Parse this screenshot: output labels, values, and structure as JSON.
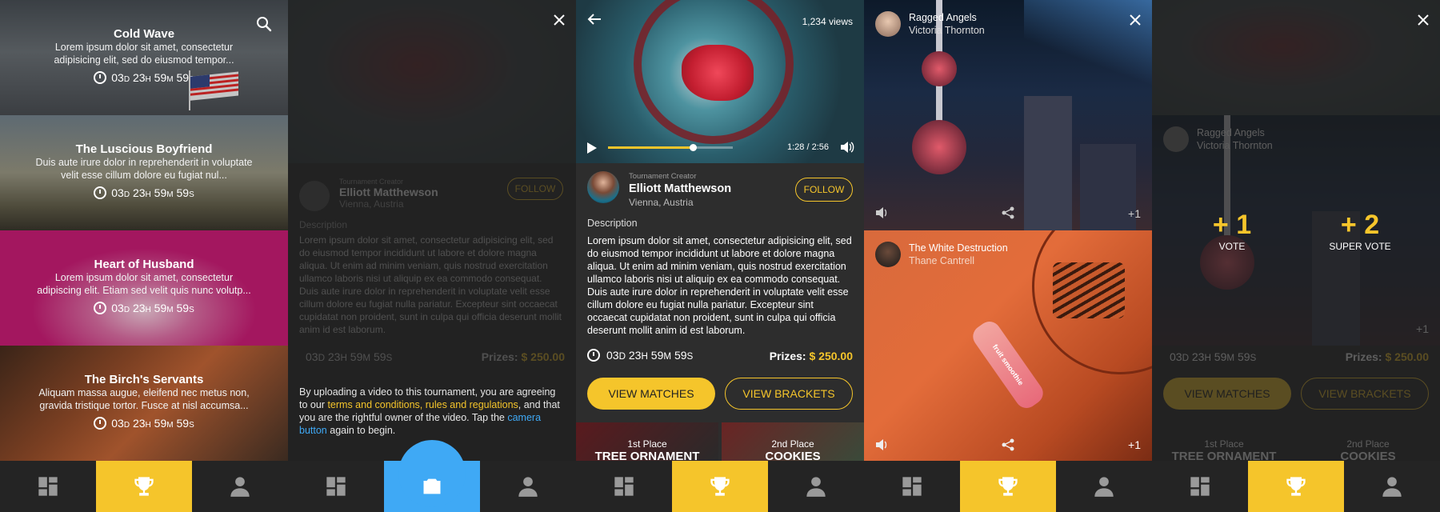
{
  "panel1": {
    "cards": [
      {
        "title": "Cold Wave",
        "desc": "Lorem ipsum dolor sit amet, consectetur adipisicing elit, sed do eiusmod tempor...",
        "timer": {
          "d": "03",
          "h": "23",
          "m": "59",
          "s": "59"
        }
      },
      {
        "title": "The Luscious Boyfriend",
        "desc": "Duis aute irure dolor in reprehenderit in voluptate velit esse cillum dolore eu fugiat nul...",
        "timer": {
          "d": "03",
          "h": "23",
          "m": "59",
          "s": "59"
        }
      },
      {
        "title": "Heart of Husband",
        "desc": "Lorem ipsum dolor sit amet, consectetur adipiscing elit. Etiam sed velit quis nunc volutp...",
        "timer": {
          "d": "03",
          "h": "23",
          "m": "59",
          "s": "59"
        }
      },
      {
        "title": "The Birch's Servants",
        "desc": "Aliquam massa augue, eleifend nec metus non, gravida tristique tortor. Fusce at nisl accumsa...",
        "timer": {
          "d": "03",
          "h": "23",
          "m": "59",
          "s": "59"
        }
      }
    ]
  },
  "unit_labels": {
    "d": "D",
    "h": "H",
    "m": "M",
    "s": "S"
  },
  "video": {
    "views": "1,234 views",
    "time": "1:28 / 2:56",
    "progress": 0.68
  },
  "creator": {
    "role": "Tournament Creator",
    "name": "Elliott Matthewson",
    "location": "Vienna, Austria",
    "follow": "FOLLOW"
  },
  "description": {
    "heading": "Description",
    "body": "Lorem ipsum dolor sit amet, consectetur adipisicing elit, sed do eiusmod tempor incididunt ut labore et dolore magna aliqua. Ut enim ad minim veniam, quis nostrud exercitation ullamco laboris nisi ut aliquip ex ea commodo consequat. Duis aute irure dolor in reprehenderit in voluptate velit esse cillum dolore eu fugiat nulla pariatur. Excepteur sint occaecat cupidatat non proident, sunt in culpa qui officia deserunt mollit anim id est laborum."
  },
  "timer": {
    "d": "03",
    "h": "23",
    "m": "59",
    "s": "59"
  },
  "prizes": {
    "label": "Prizes:",
    "value": "$ 250.00"
  },
  "buttons": {
    "view_matches": "VIEW MATCHES",
    "view_brackets": "VIEW BRACKETS"
  },
  "places": [
    {
      "place": "1st Place",
      "name": "TREE ORNAMENT"
    },
    {
      "place": "2nd Place",
      "name": "COOKIES"
    }
  ],
  "upload": {
    "p1": "By uploading a video to this tournament, you are agreeing to our ",
    "link1": "terms and conditions, rules and regulations",
    "p2": ", and that you are the rightful owner of the video. Tap the ",
    "link2": "camera button",
    "p3": " again to begin."
  },
  "match": {
    "top": {
      "title": "Ragged Angels",
      "user": "Victoria Thornton",
      "count": "+1"
    },
    "bottom": {
      "title": "The White Destruction",
      "user": "Thane Cantrell",
      "count": "+1",
      "bottle_text": "fruit smoothie"
    }
  },
  "votes": {
    "vote": {
      "value": "+ 1",
      "label": "VOTE"
    },
    "super": {
      "value": "+ 2",
      "label": "SUPER VOTE"
    }
  },
  "colors": {
    "accent": "#f5c52b",
    "camera": "#3fa9f5",
    "magenta": "#a3175f",
    "link": "#3fa9f5"
  }
}
